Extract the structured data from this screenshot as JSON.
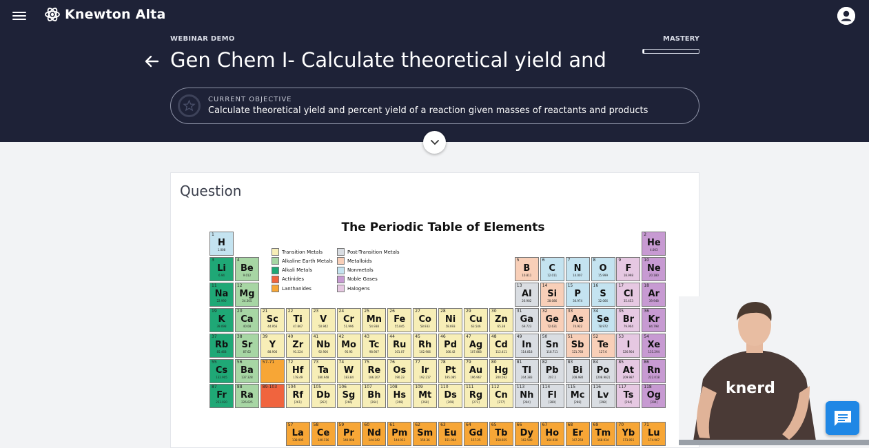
{
  "app": {
    "name": "Knewton Alta"
  },
  "header": {
    "kicker": "WEBINAR DEMO",
    "title": "Gen Chem I- Calculate theoretical yield and perc...",
    "mastery_label": "MASTERY",
    "mastery_progress": 0.02
  },
  "objective": {
    "label": "CURRENT OBJECTIVE",
    "text": "Calculate theoretical yield and percent yield of a reaction given masses of reactants and products"
  },
  "question": {
    "heading": "Question"
  },
  "periodic_table": {
    "title": "The Periodic Table of Elements",
    "colors": {
      "transition": "#f7eeb7",
      "alkaline": "#a7d6a4",
      "alkali": "#1fa876",
      "actinide": "#f0643e",
      "lanthanide": "#f7a636",
      "post": "#d9dde2",
      "metalloid": "#f8cfb8",
      "nonmetal": "#c4e3f0",
      "noble": "#c79ad2",
      "halogen": "#e6c8e2"
    },
    "legend": [
      {
        "label": "Transition Metals",
        "cat": "transition"
      },
      {
        "label": "Alkaline Earth Metals",
        "cat": "alkaline"
      },
      {
        "label": "Alkali Metals",
        "cat": "alkali"
      },
      {
        "label": "Actinides",
        "cat": "actinide"
      },
      {
        "label": "Lanthanides",
        "cat": "lanthanide"
      },
      {
        "label": "Post-Transition Metals",
        "cat": "post"
      },
      {
        "label": "Metalloids",
        "cat": "metalloid"
      },
      {
        "label": "Nonmetals",
        "cat": "nonmetal"
      },
      {
        "label": "Noble Gases",
        "cat": "noble"
      },
      {
        "label": "Halogens",
        "cat": "halogen"
      }
    ],
    "elements": [
      {
        "n": "1",
        "s": "H",
        "m": "1.008",
        "r": 1,
        "c": 1,
        "cat": "nonmetal"
      },
      {
        "n": "2",
        "s": "He",
        "m": "4.003",
        "r": 1,
        "c": 18,
        "cat": "noble"
      },
      {
        "n": "3",
        "s": "Li",
        "m": "6.94",
        "r": 2,
        "c": 1,
        "cat": "alkali"
      },
      {
        "n": "4",
        "s": "Be",
        "m": "9.012",
        "r": 2,
        "c": 2,
        "cat": "alkaline"
      },
      {
        "n": "5",
        "s": "B",
        "m": "10.811",
        "r": 2,
        "c": 13,
        "cat": "metalloid"
      },
      {
        "n": "6",
        "s": "C",
        "m": "12.011",
        "r": 2,
        "c": 14,
        "cat": "nonmetal"
      },
      {
        "n": "7",
        "s": "N",
        "m": "14.007",
        "r": 2,
        "c": 15,
        "cat": "nonmetal"
      },
      {
        "n": "8",
        "s": "O",
        "m": "15.999",
        "r": 2,
        "c": 16,
        "cat": "nonmetal"
      },
      {
        "n": "9",
        "s": "F",
        "m": "18.998",
        "r": 2,
        "c": 17,
        "cat": "halogen"
      },
      {
        "n": "10",
        "s": "Ne",
        "m": "20.180",
        "r": 2,
        "c": 18,
        "cat": "noble"
      },
      {
        "n": "11",
        "s": "Na",
        "m": "22.990",
        "r": 3,
        "c": 1,
        "cat": "alkali"
      },
      {
        "n": "12",
        "s": "Mg",
        "m": "24.305",
        "r": 3,
        "c": 2,
        "cat": "alkaline"
      },
      {
        "n": "13",
        "s": "Al",
        "m": "26.982",
        "r": 3,
        "c": 13,
        "cat": "post"
      },
      {
        "n": "14",
        "s": "Si",
        "m": "28.086",
        "r": 3,
        "c": 14,
        "cat": "metalloid"
      },
      {
        "n": "15",
        "s": "P",
        "m": "30.974",
        "r": 3,
        "c": 15,
        "cat": "nonmetal"
      },
      {
        "n": "16",
        "s": "S",
        "m": "32.066",
        "r": 3,
        "c": 16,
        "cat": "nonmetal"
      },
      {
        "n": "17",
        "s": "Cl",
        "m": "35.453",
        "r": 3,
        "c": 17,
        "cat": "halogen"
      },
      {
        "n": "18",
        "s": "Ar",
        "m": "39.948",
        "r": 3,
        "c": 18,
        "cat": "noble"
      },
      {
        "n": "19",
        "s": "K",
        "m": "39.098",
        "r": 4,
        "c": 1,
        "cat": "alkali"
      },
      {
        "n": "20",
        "s": "Ca",
        "m": "40.08",
        "r": 4,
        "c": 2,
        "cat": "alkaline"
      },
      {
        "n": "21",
        "s": "Sc",
        "m": "44.956",
        "r": 4,
        "c": 3,
        "cat": "transition"
      },
      {
        "n": "22",
        "s": "Ti",
        "m": "47.867",
        "r": 4,
        "c": 4,
        "cat": "transition"
      },
      {
        "n": "23",
        "s": "V",
        "m": "50.942",
        "r": 4,
        "c": 5,
        "cat": "transition"
      },
      {
        "n": "24",
        "s": "Cr",
        "m": "51.996",
        "r": 4,
        "c": 6,
        "cat": "transition"
      },
      {
        "n": "25",
        "s": "Mn",
        "m": "54.938",
        "r": 4,
        "c": 7,
        "cat": "transition"
      },
      {
        "n": "26",
        "s": "Fe",
        "m": "55.845",
        "r": 4,
        "c": 8,
        "cat": "transition"
      },
      {
        "n": "27",
        "s": "Co",
        "m": "58.933",
        "r": 4,
        "c": 9,
        "cat": "transition"
      },
      {
        "n": "28",
        "s": "Ni",
        "m": "58.693",
        "r": 4,
        "c": 10,
        "cat": "transition"
      },
      {
        "n": "29",
        "s": "Cu",
        "m": "63.546",
        "r": 4,
        "c": 11,
        "cat": "transition"
      },
      {
        "n": "30",
        "s": "Zn",
        "m": "65.38",
        "r": 4,
        "c": 12,
        "cat": "transition"
      },
      {
        "n": "31",
        "s": "Ga",
        "m": "69.723",
        "r": 4,
        "c": 13,
        "cat": "post"
      },
      {
        "n": "32",
        "s": "Ge",
        "m": "72.631",
        "r": 4,
        "c": 14,
        "cat": "metalloid"
      },
      {
        "n": "33",
        "s": "As",
        "m": "74.922",
        "r": 4,
        "c": 15,
        "cat": "metalloid"
      },
      {
        "n": "34",
        "s": "Se",
        "m": "78.972",
        "r": 4,
        "c": 16,
        "cat": "nonmetal"
      },
      {
        "n": "35",
        "s": "Br",
        "m": "79.904",
        "r": 4,
        "c": 17,
        "cat": "halogen"
      },
      {
        "n": "36",
        "s": "Kr",
        "m": "84.798",
        "r": 4,
        "c": 18,
        "cat": "noble"
      },
      {
        "n": "37",
        "s": "Rb",
        "m": "85.468",
        "r": 5,
        "c": 1,
        "cat": "alkali"
      },
      {
        "n": "38",
        "s": "Sr",
        "m": "87.62",
        "r": 5,
        "c": 2,
        "cat": "alkaline"
      },
      {
        "n": "39",
        "s": "Y",
        "m": "88.906",
        "r": 5,
        "c": 3,
        "cat": "transition"
      },
      {
        "n": "40",
        "s": "Zr",
        "m": "91.224",
        "r": 5,
        "c": 4,
        "cat": "transition"
      },
      {
        "n": "41",
        "s": "Nb",
        "m": "92.906",
        "r": 5,
        "c": 5,
        "cat": "transition"
      },
      {
        "n": "42",
        "s": "Mo",
        "m": "95.95",
        "r": 5,
        "c": 6,
        "cat": "transition"
      },
      {
        "n": "43",
        "s": "Tc",
        "m": "98.907",
        "r": 5,
        "c": 7,
        "cat": "transition"
      },
      {
        "n": "44",
        "s": "Ru",
        "m": "101.07",
        "r": 5,
        "c": 8,
        "cat": "transition"
      },
      {
        "n": "45",
        "s": "Rh",
        "m": "102.906",
        "r": 5,
        "c": 9,
        "cat": "transition"
      },
      {
        "n": "46",
        "s": "Pd",
        "m": "106.42",
        "r": 5,
        "c": 10,
        "cat": "transition"
      },
      {
        "n": "47",
        "s": "Ag",
        "m": "107.868",
        "r": 5,
        "c": 11,
        "cat": "transition"
      },
      {
        "n": "48",
        "s": "Cd",
        "m": "112.411",
        "r": 5,
        "c": 12,
        "cat": "transition"
      },
      {
        "n": "49",
        "s": "In",
        "m": "114.818",
        "r": 5,
        "c": 13,
        "cat": "post"
      },
      {
        "n": "50",
        "s": "Sn",
        "m": "118.711",
        "r": 5,
        "c": 14,
        "cat": "post"
      },
      {
        "n": "51",
        "s": "Sb",
        "m": "121.760",
        "r": 5,
        "c": 15,
        "cat": "metalloid"
      },
      {
        "n": "52",
        "s": "Te",
        "m": "127.6",
        "r": 5,
        "c": 16,
        "cat": "metalloid"
      },
      {
        "n": "53",
        "s": "I",
        "m": "126.904",
        "r": 5,
        "c": 17,
        "cat": "halogen"
      },
      {
        "n": "54",
        "s": "Xe",
        "m": "131.294",
        "r": 5,
        "c": 18,
        "cat": "noble"
      },
      {
        "n": "55",
        "s": "Cs",
        "m": "132.905",
        "r": 6,
        "c": 1,
        "cat": "alkali"
      },
      {
        "n": "56",
        "s": "Ba",
        "m": "137.328",
        "r": 6,
        "c": 2,
        "cat": "alkaline"
      },
      {
        "n": "57-71",
        "s": "",
        "m": "",
        "r": 6,
        "c": 3,
        "cat": "lanthanide"
      },
      {
        "n": "72",
        "s": "Hf",
        "m": "178.49",
        "r": 6,
        "c": 4,
        "cat": "transition"
      },
      {
        "n": "73",
        "s": "Ta",
        "m": "180.948",
        "r": 6,
        "c": 5,
        "cat": "transition"
      },
      {
        "n": "74",
        "s": "W",
        "m": "183.84",
        "r": 6,
        "c": 6,
        "cat": "transition"
      },
      {
        "n": "75",
        "s": "Re",
        "m": "186.207",
        "r": 6,
        "c": 7,
        "cat": "transition"
      },
      {
        "n": "76",
        "s": "Os",
        "m": "190.23",
        "r": 6,
        "c": 8,
        "cat": "transition"
      },
      {
        "n": "77",
        "s": "Ir",
        "m": "192.217",
        "r": 6,
        "c": 9,
        "cat": "transition"
      },
      {
        "n": "78",
        "s": "Pt",
        "m": "195.085",
        "r": 6,
        "c": 10,
        "cat": "transition"
      },
      {
        "n": "79",
        "s": "Au",
        "m": "196.967",
        "r": 6,
        "c": 11,
        "cat": "transition"
      },
      {
        "n": "80",
        "s": "Hg",
        "m": "200.592",
        "r": 6,
        "c": 12,
        "cat": "transition"
      },
      {
        "n": "81",
        "s": "Tl",
        "m": "204.383",
        "r": 6,
        "c": 13,
        "cat": "post"
      },
      {
        "n": "82",
        "s": "Pb",
        "m": "207.2",
        "r": 6,
        "c": 14,
        "cat": "post"
      },
      {
        "n": "83",
        "s": "Bi",
        "m": "208.980",
        "r": 6,
        "c": 15,
        "cat": "post"
      },
      {
        "n": "84",
        "s": "Po",
        "m": "[208.982]",
        "r": 6,
        "c": 16,
        "cat": "post"
      },
      {
        "n": "85",
        "s": "At",
        "m": "209.987",
        "r": 6,
        "c": 17,
        "cat": "halogen"
      },
      {
        "n": "86",
        "s": "Rn",
        "m": "222.018",
        "r": 6,
        "c": 18,
        "cat": "noble"
      },
      {
        "n": "87",
        "s": "Fr",
        "m": "223.020",
        "r": 7,
        "c": 1,
        "cat": "alkali"
      },
      {
        "n": "88",
        "s": "Ra",
        "m": "226.025",
        "r": 7,
        "c": 2,
        "cat": "alkaline"
      },
      {
        "n": "89-103",
        "s": "",
        "m": "",
        "r": 7,
        "c": 3,
        "cat": "actinide"
      },
      {
        "n": "104",
        "s": "Rf",
        "m": "[261]",
        "r": 7,
        "c": 4,
        "cat": "transition"
      },
      {
        "n": "105",
        "s": "Db",
        "m": "[262]",
        "r": 7,
        "c": 5,
        "cat": "transition"
      },
      {
        "n": "106",
        "s": "Sg",
        "m": "[266]",
        "r": 7,
        "c": 6,
        "cat": "transition"
      },
      {
        "n": "107",
        "s": "Bh",
        "m": "[264]",
        "r": 7,
        "c": 7,
        "cat": "transition"
      },
      {
        "n": "108",
        "s": "Hs",
        "m": "[269]",
        "r": 7,
        "c": 8,
        "cat": "transition"
      },
      {
        "n": "109",
        "s": "Mt",
        "m": "[268]",
        "r": 7,
        "c": 9,
        "cat": "transition"
      },
      {
        "n": "110",
        "s": "Ds",
        "m": "[269]",
        "r": 7,
        "c": 10,
        "cat": "transition"
      },
      {
        "n": "111",
        "s": "Rg",
        "m": "[272]",
        "r": 7,
        "c": 11,
        "cat": "transition"
      },
      {
        "n": "112",
        "s": "Cn",
        "m": "[277]",
        "r": 7,
        "c": 12,
        "cat": "transition"
      },
      {
        "n": "113",
        "s": "Nh",
        "m": "[284]",
        "r": 7,
        "c": 13,
        "cat": "post"
      },
      {
        "n": "114",
        "s": "Fl",
        "m": "[289]",
        "r": 7,
        "c": 14,
        "cat": "post"
      },
      {
        "n": "115",
        "s": "Mc",
        "m": "[288]",
        "r": 7,
        "c": 15,
        "cat": "post"
      },
      {
        "n": "116",
        "s": "Lv",
        "m": "[298]",
        "r": 7,
        "c": 16,
        "cat": "post"
      },
      {
        "n": "117",
        "s": "Ts",
        "m": "[294]",
        "r": 7,
        "c": 17,
        "cat": "halogen"
      },
      {
        "n": "118",
        "s": "Og",
        "m": "[294]",
        "r": 7,
        "c": 18,
        "cat": "noble"
      },
      {
        "n": "57",
        "s": "La",
        "m": "138.905",
        "r": 9,
        "c": 4,
        "cat": "lanthanide"
      },
      {
        "n": "58",
        "s": "Ce",
        "m": "140.116",
        "r": 9,
        "c": 5,
        "cat": "lanthanide"
      },
      {
        "n": "59",
        "s": "Pr",
        "m": "140.908",
        "r": 9,
        "c": 6,
        "cat": "lanthanide"
      },
      {
        "n": "60",
        "s": "Nd",
        "m": "144.242",
        "r": 9,
        "c": 7,
        "cat": "lanthanide"
      },
      {
        "n": "61",
        "s": "Pm",
        "m": "144.913",
        "r": 9,
        "c": 8,
        "cat": "lanthanide"
      },
      {
        "n": "62",
        "s": "Sm",
        "m": "150.36",
        "r": 9,
        "c": 9,
        "cat": "lanthanide"
      },
      {
        "n": "63",
        "s": "Eu",
        "m": "151.964",
        "r": 9,
        "c": 10,
        "cat": "lanthanide"
      },
      {
        "n": "64",
        "s": "Gd",
        "m": "157.25",
        "r": 9,
        "c": 11,
        "cat": "lanthanide"
      },
      {
        "n": "65",
        "s": "Tb",
        "m": "158.925",
        "r": 9,
        "c": 12,
        "cat": "lanthanide"
      },
      {
        "n": "66",
        "s": "Dy",
        "m": "162.500",
        "r": 9,
        "c": 13,
        "cat": "lanthanide"
      },
      {
        "n": "67",
        "s": "Ho",
        "m": "164.930",
        "r": 9,
        "c": 14,
        "cat": "lanthanide"
      },
      {
        "n": "68",
        "s": "Er",
        "m": "167.259",
        "r": 9,
        "c": 15,
        "cat": "lanthanide"
      },
      {
        "n": "69",
        "s": "Tm",
        "m": "168.934",
        "r": 9,
        "c": 16,
        "cat": "lanthanide"
      },
      {
        "n": "70",
        "s": "Yb",
        "m": "173.055",
        "r": 9,
        "c": 17,
        "cat": "lanthanide"
      },
      {
        "n": "71",
        "s": "Lu",
        "m": "174.967",
        "r": 9,
        "c": 18,
        "cat": "lanthanide"
      }
    ]
  },
  "video": {
    "shirt_text": "knerd"
  },
  "icons": {
    "menu": "menu-icon",
    "account": "account-icon",
    "back": "arrow-left-icon",
    "expand": "chevron-down-icon",
    "chat": "chat-icon",
    "objective": "star-icon"
  }
}
